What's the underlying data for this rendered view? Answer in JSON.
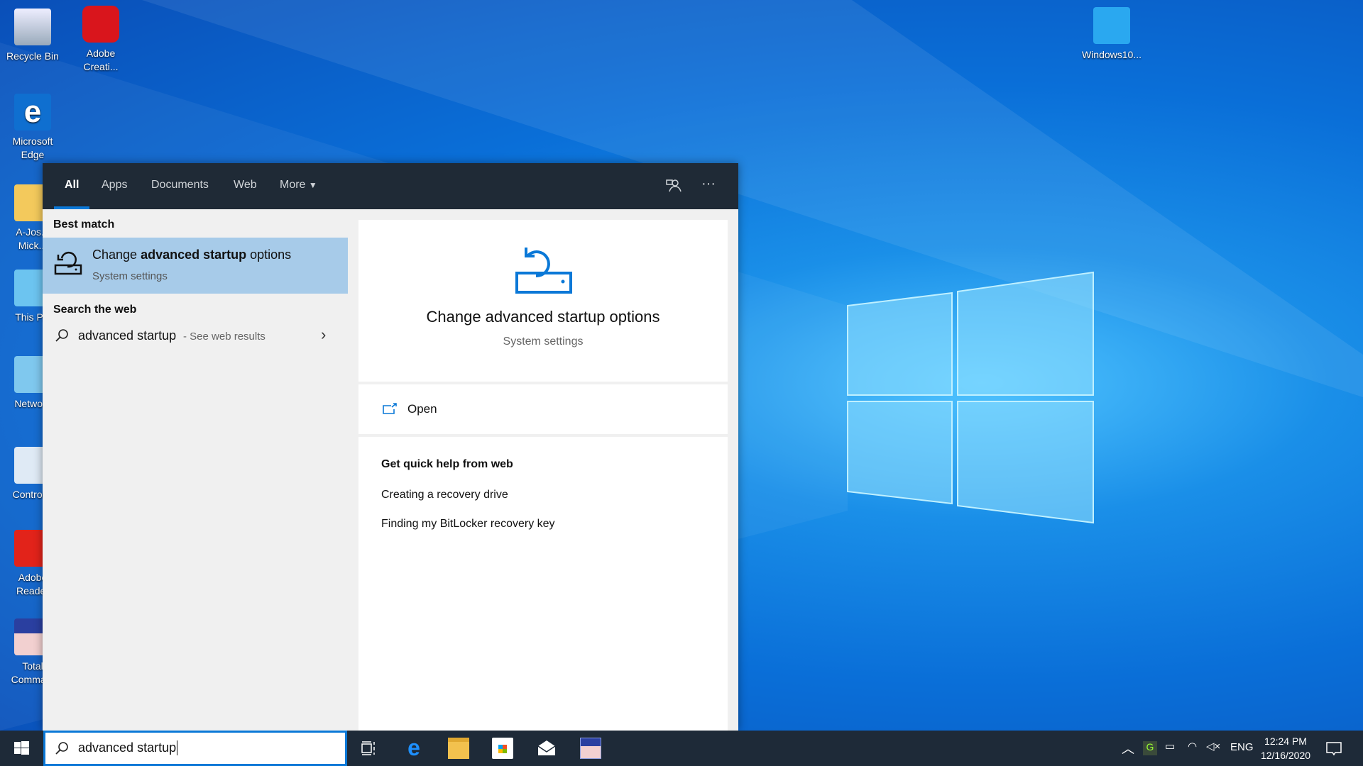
{
  "desktop": {
    "icons": [
      {
        "label": "Recycle Bin"
      },
      {
        "label": "Adobe Creati..."
      },
      {
        "label": "Microsoft Edge"
      },
      {
        "label": "A-Jos... Mick..."
      },
      {
        "label": "This P..."
      },
      {
        "label": "Netwo..."
      },
      {
        "label": "Control..."
      },
      {
        "label": "Adobe Reader"
      },
      {
        "label": "Total Comma..."
      },
      {
        "label": "Windows10..."
      }
    ]
  },
  "search_panel": {
    "tabs": [
      {
        "label": "All",
        "active": true
      },
      {
        "label": "Apps"
      },
      {
        "label": "Documents"
      },
      {
        "label": "Web"
      },
      {
        "label": "More"
      }
    ],
    "feedback_icon": "feedback-icon",
    "more_options": "···",
    "best_match_heading": "Best match",
    "best_match": {
      "title_pre": "Change ",
      "title_bold": "advanced startup",
      "title_post": " options",
      "subtitle": "System settings"
    },
    "search_web_heading": "Search the web",
    "web_result": {
      "query": "advanced startup",
      "suffix": " - See web results"
    },
    "preview": {
      "title": "Change advanced startup options",
      "subtitle": "System settings",
      "open_label": "Open",
      "help_heading": "Get quick help from web",
      "help_links": [
        "Creating a recovery drive",
        "Finding my BitLocker recovery key"
      ]
    },
    "accent": "#0a78d7"
  },
  "taskbar": {
    "search_value": "advanced startup",
    "tray": {
      "language": "ENG",
      "time": "12:24 PM",
      "date": "12/16/2020"
    }
  }
}
